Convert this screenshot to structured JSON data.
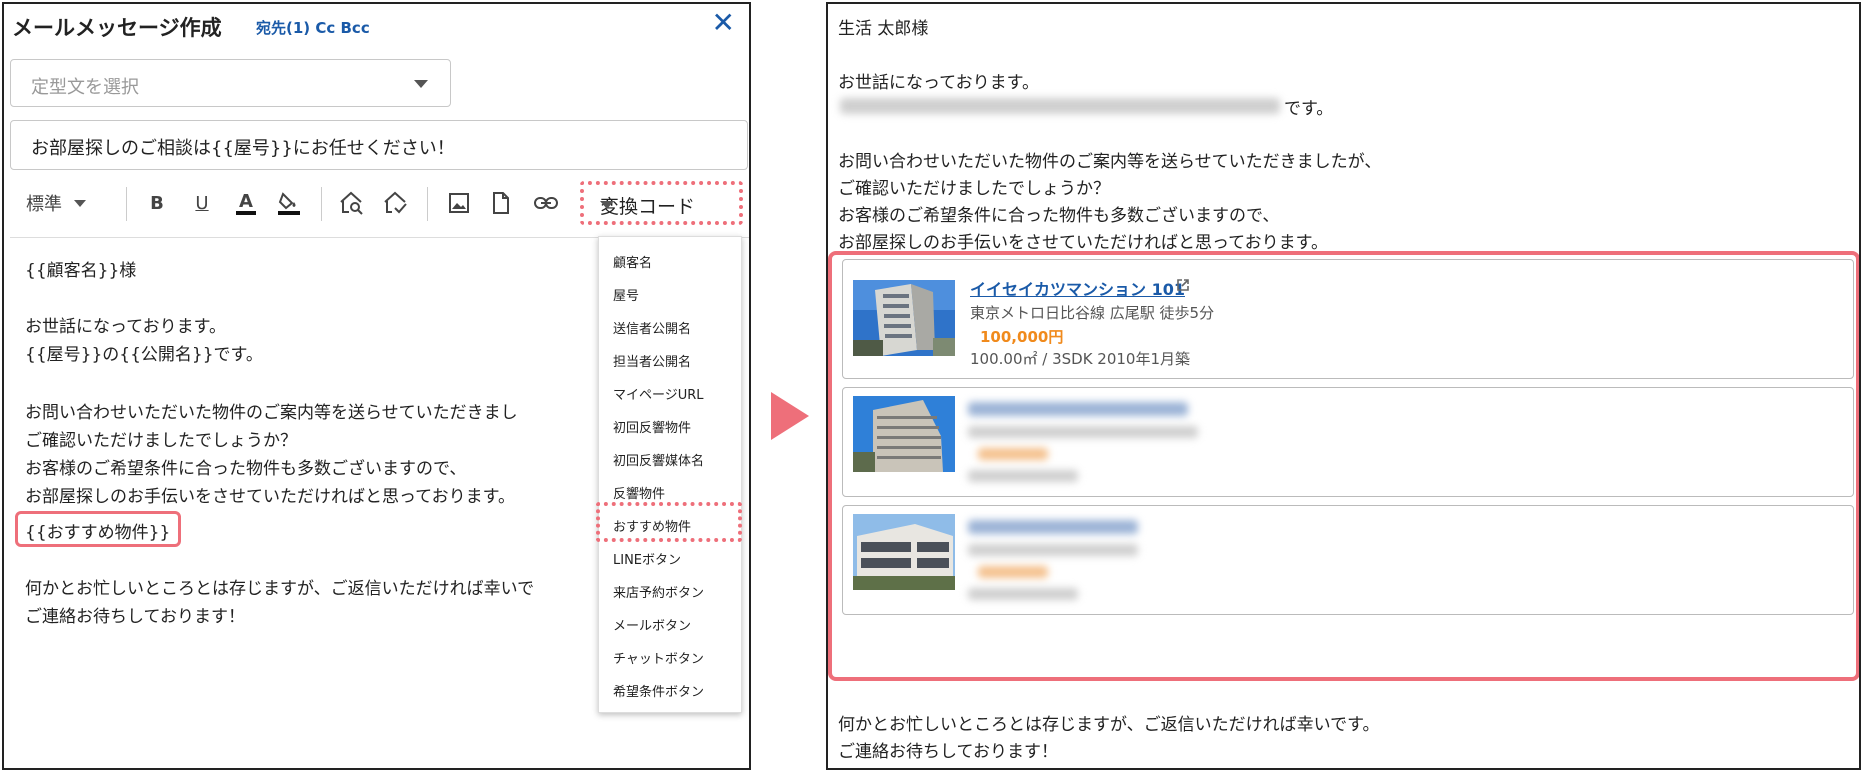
{
  "left": {
    "header": {
      "title": "メールメッセージ作成",
      "recipients": "宛先(1) Cc Bcc",
      "close_icon": "close-icon"
    },
    "template_select": {
      "placeholder": "定型文を選択"
    },
    "subject": {
      "value": "お部屋探しのご相談は{{屋号}}にお任せください！"
    },
    "toolbar": {
      "size_label": "標準",
      "buttons": [
        "bold-icon",
        "underline-icon",
        "font-color-icon",
        "fill-color-icon",
        "search-replace-icon",
        "redo-icon",
        "image-icon",
        "file-icon",
        "link-icon"
      ],
      "convert_label": "変換コード"
    },
    "body_lines": [
      "{{顧客名}}様",
      "",
      "お世話になっております。",
      "{{屋号}}の{{公開名}}です。",
      "",
      "お問い合わせいただいた物件のご案内等を送らせていただきまし",
      "ご確認いただけましたでしょうか？",
      "お客様のご希望条件に合った物件も多数ございますので、",
      "お部屋探しのお手伝いをさせていただければと思っております。",
      "{{おすすめ物件}}",
      "",
      "何かとお忙しいところとは存じますが、ご返信いただければ幸いで",
      "ご連絡お待ちしております！"
    ],
    "dropdown_items": [
      "顧客名",
      "屋号",
      "送信者公開名",
      "担当者公開名",
      "マイページURL",
      "初回反響物件",
      "初回反響媒体名",
      "反響物件",
      "おすすめ物件",
      "LINEボタン",
      "来店予約ボタン",
      "メールボタン",
      "チャットボタン",
      "希望条件ボタン"
    ]
  },
  "right": {
    "lines_top": [
      "生活 太郎様",
      "",
      "お世話になっております。",
      "です。",
      "",
      "お問い合わせいただいた物件のご案内等を送らせていただきましたが、",
      "ご確認いただけましたでしょうか？",
      "お客様のご希望条件に合った物件も多数ございますので、",
      "お部屋探しのお手伝いをさせていただければと思っております。"
    ],
    "property": {
      "name": "イイセイカツマンション 101",
      "station": "東京メトロ日比谷線 広尾駅 徒歩5分",
      "price": "100,000円",
      "detail": "100.00㎡ / 3SDK  2010年1月築"
    },
    "lines_bottom": [
      "何かとお忙しいところとは存じますが、ご返信いただければ幸いです。",
      "ご連絡お待ちしております！"
    ]
  },
  "colors": {
    "accent": "#ee6f7a",
    "link": "#1a5aa8",
    "price": "#f08a1c"
  }
}
